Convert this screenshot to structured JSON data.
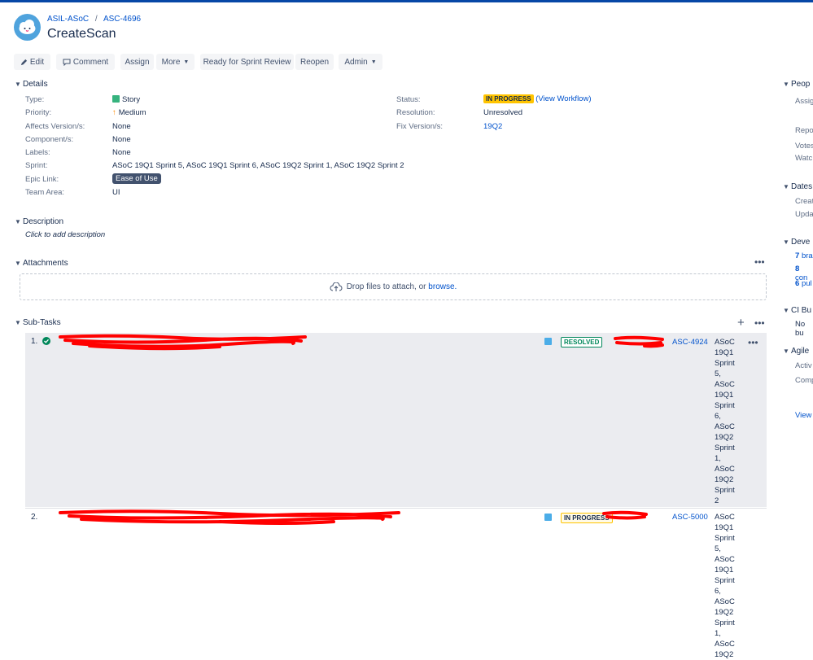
{
  "breadcrumb": {
    "project": "ASIL-ASoC",
    "separator": "/",
    "issue_key": "ASC-4696"
  },
  "issue": {
    "title": "CreateScan"
  },
  "toolbar": {
    "edit": "Edit",
    "comment": "Comment",
    "assign": "Assign",
    "more": "More",
    "ready": "Ready for Sprint Review",
    "reopen": "Reopen",
    "admin": "Admin"
  },
  "details": {
    "heading": "Details",
    "left": [
      {
        "label": "Type:",
        "value": "Story"
      },
      {
        "label": "Priority:",
        "value": "Medium"
      },
      {
        "label": "Affects Version/s:",
        "value": "None"
      },
      {
        "label": "Component/s:",
        "value": "None"
      },
      {
        "label": "Labels:",
        "value": "None"
      },
      {
        "label": "Sprint:",
        "value": "ASoC 19Q1 Sprint 5, ASoC 19Q1 Sprint 6, ASoC 19Q2 Sprint 1, ASoC 19Q2 Sprint 2"
      },
      {
        "label": "Epic Link:",
        "value": "Ease of Use"
      },
      {
        "label": "Team Area:",
        "value": "UI"
      }
    ],
    "status_label": "Status:",
    "status_value": "IN PROGRESS",
    "view_workflow": "(View Workflow)",
    "resolution_label": "Resolution:",
    "resolution_value": "Unresolved",
    "fix_label": "Fix Version/s:",
    "fix_value": "19Q2"
  },
  "description": {
    "heading": "Description",
    "placeholder": "Click to add description"
  },
  "attachments": {
    "heading": "Attachments",
    "drop_text": "Drop files to attach, or",
    "browse": "browse."
  },
  "subtasks": {
    "heading": "Sub-Tasks",
    "rows": [
      {
        "num": "1.",
        "status": "RESOLVED",
        "key": "ASC-4924",
        "sprints": [
          "ASoC",
          "19Q1",
          "Sprint",
          "5,",
          "ASoC",
          "19Q1",
          "Sprint",
          "6,",
          "ASoC",
          "19Q2",
          "Sprint",
          "1,",
          "ASoC",
          "19Q2",
          "Sprint",
          "2"
        ]
      },
      {
        "num": "2.",
        "status": "IN PROGRESS",
        "key": "ASC-5000",
        "sprints": [
          "ASoC",
          "19Q1",
          "Sprint",
          "5,",
          "ASoC",
          "19Q1",
          "Sprint",
          "6,",
          "ASoC",
          "19Q2",
          "Sprint",
          "1,",
          "ASoC",
          "19Q2"
        ]
      }
    ]
  },
  "sidebar": {
    "people": "Peop",
    "assignee": "Assig",
    "reporter": "Repo",
    "votes": "Votes",
    "watchers": "Watc",
    "dates": "Dates",
    "created": "Creat",
    "updated": "Upda",
    "development": "Deve",
    "dev_branches_count": "7",
    "dev_branches": "bra",
    "dev_commits_count": "8",
    "dev_commits": "con",
    "dev_pulls_count": "6",
    "dev_pulls": "pul",
    "ci": "CI Bu",
    "ci_value": "No bu",
    "agile": "Agile",
    "agile_active": "Activ",
    "agile_completed": "Comp",
    "agile_view": "View"
  },
  "colors": {
    "accent": "#0052cc",
    "topbar": "#0747a6",
    "inprogress_bg": "#ffc400",
    "resolved": "#00875a",
    "redaction": "#ff0000"
  }
}
